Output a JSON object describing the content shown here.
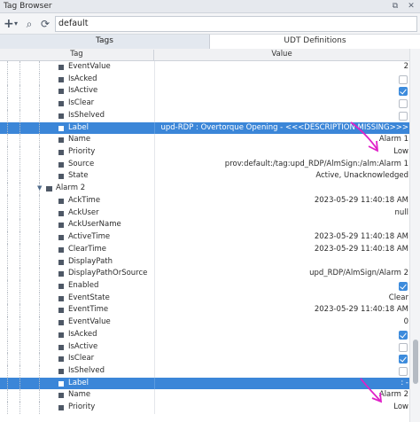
{
  "window": {
    "title": "Tag Browser",
    "restore_glyph": "⧉",
    "close_glyph": "✕"
  },
  "toolbar": {
    "add_glyph": "+",
    "dropdown_glyph": "▾",
    "search_glyph": "⌕",
    "refresh_glyph": "⟳",
    "provider_value": "default"
  },
  "tabs": [
    {
      "label": "Tags",
      "active": true
    },
    {
      "label": "UDT Definitions",
      "active": false
    }
  ],
  "columns": {
    "tag": "Tag",
    "value": "Value"
  },
  "rows": [
    {
      "name": "EventValue",
      "value": "2",
      "kind": "text"
    },
    {
      "name": "IsAcked",
      "kind": "checkbox",
      "checked": false
    },
    {
      "name": "IsActive",
      "kind": "checkbox",
      "checked": true
    },
    {
      "name": "IsClear",
      "kind": "checkbox",
      "checked": false
    },
    {
      "name": "IsShelved",
      "kind": "checkbox",
      "checked": false
    },
    {
      "name": "Label",
      "value": "upd-RDP : Overtorque Opening - <<<DESCRIPTION MISSING>>>",
      "kind": "text",
      "selected": true
    },
    {
      "name": "Name",
      "value": "Alarm 1",
      "kind": "text"
    },
    {
      "name": "Priority",
      "value": "Low",
      "kind": "text"
    },
    {
      "name": "Source",
      "value": "prov:default:/tag:upd_RDP/AlmSign:/alm:Alarm 1",
      "kind": "text"
    },
    {
      "name": "State",
      "value": "Active, Unacknowledged",
      "kind": "text"
    },
    {
      "name": "Alarm 2",
      "kind": "group"
    },
    {
      "name": "AckTime",
      "value": "2023-05-29 11:40:18 AM",
      "kind": "text"
    },
    {
      "name": "AckUser",
      "value": "null",
      "kind": "text"
    },
    {
      "name": "AckUserName",
      "value": "",
      "kind": "text"
    },
    {
      "name": "ActiveTime",
      "value": "2023-05-29 11:40:18 AM",
      "kind": "text"
    },
    {
      "name": "ClearTime",
      "value": "2023-05-29 11:40:18 AM",
      "kind": "text"
    },
    {
      "name": "DisplayPath",
      "value": "",
      "kind": "text"
    },
    {
      "name": "DisplayPathOrSource",
      "value": "upd_RDP/AlmSign/Alarm 2",
      "kind": "text"
    },
    {
      "name": "Enabled",
      "kind": "checkbox",
      "checked": true
    },
    {
      "name": "EventState",
      "value": "Clear",
      "kind": "text"
    },
    {
      "name": "EventTime",
      "value": "2023-05-29 11:40:18 AM",
      "kind": "text"
    },
    {
      "name": "EventValue",
      "value": "0",
      "kind": "text"
    },
    {
      "name": "IsAcked",
      "kind": "checkbox",
      "checked": true
    },
    {
      "name": "IsActive",
      "kind": "checkbox",
      "checked": false
    },
    {
      "name": "IsClear",
      "kind": "checkbox",
      "checked": true
    },
    {
      "name": "IsShelved",
      "kind": "checkbox",
      "checked": false
    },
    {
      "name": "Label",
      "value": ": -",
      "kind": "text",
      "selected": true
    },
    {
      "name": "Name",
      "value": "Alarm 2",
      "kind": "text"
    },
    {
      "name": "Priority",
      "value": "Low",
      "kind": "text"
    }
  ],
  "colors": {
    "selection": "#3b86d8",
    "annotation": "#e020c8"
  }
}
